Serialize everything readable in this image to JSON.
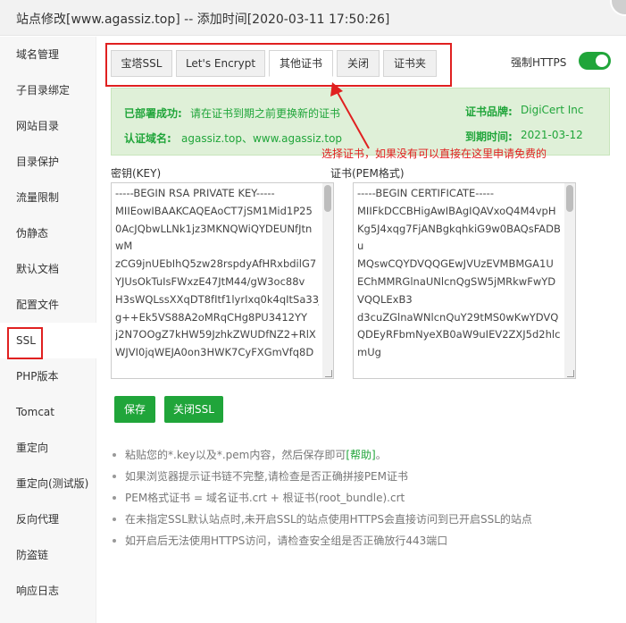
{
  "window": {
    "title": "站点修改[www.agassiz.top] -- 添加时间[2020-03-11 17:50:26]"
  },
  "sidebar": {
    "items": [
      {
        "label": "域名管理"
      },
      {
        "label": "子目录绑定"
      },
      {
        "label": "网站目录"
      },
      {
        "label": "目录保护"
      },
      {
        "label": "流量限制"
      },
      {
        "label": "伪静态"
      },
      {
        "label": "默认文档"
      },
      {
        "label": "配置文件"
      },
      {
        "label": "SSL"
      },
      {
        "label": "PHP版本"
      },
      {
        "label": "Tomcat"
      },
      {
        "label": "重定向"
      },
      {
        "label": "重定向(测试版)"
      },
      {
        "label": "反向代理"
      },
      {
        "label": "防盗链"
      },
      {
        "label": "响应日志"
      }
    ],
    "active": "SSL"
  },
  "tabs": [
    {
      "label": "宝塔SSL"
    },
    {
      "label": "Let's Encrypt"
    },
    {
      "label": "其他证书"
    },
    {
      "label": "关闭"
    },
    {
      "label": "证书夹"
    }
  ],
  "active_tab": "其他证书",
  "force_https": {
    "label": "强制HTTPS",
    "enabled": true
  },
  "status": {
    "deployed_label": "已部署成功:",
    "deployed_text": "请在证书到期之前更换新的证书",
    "domain_label": "认证域名:",
    "domain_value": "agassiz.top、www.agassiz.top",
    "brand_label": "证书品牌:",
    "brand_value": "DigiCert Inc",
    "expiry_label": "到期时间:",
    "expiry_value": "2021-03-12"
  },
  "annotation": {
    "text": "选择证书，如果没有可以直接在这里申请免费的"
  },
  "key_field": {
    "label": "密钥(KEY)",
    "value": "-----BEGIN RSA PRIVATE KEY-----\nMIIEowIBAAKCAQEAoCT7jSM1Mid1P25\n0AcJQbwLLNk1jz3MKNQWiQYDEUNfJtn\nwM\nzCG9jnUEbIhQ5zw28rspdyAfHRxbdilG7\nYJUsOkTuIsFWxzE47JtM44/gW3oc88v\nH3sWQLssXXqDT8fItf1lyrIxq0k4qItSa33J\ng++Ek5VS88A2oMRqCHg8PU3412YY\nj2N7OOgZ7kHW59JzhkZWUDfNZ2+RlX\nWJVI0jqWEJA0on3HWK7CyFXGmVfq8D"
  },
  "cert_field": {
    "label": "证书(PEM格式)",
    "value": "-----BEGIN CERTIFICATE-----\nMIIFkDCCBHigAwIBAgIQAVxoQ4M4vpH\nKg5J4xqg7FjANBgkqhkiG9w0BAQsFADB\nu\nMQswCQYDVQQGEwJVUzEVMBMGA1U\nEChMMRGlnaUNlcnQgSW5jMRkwFwYD\nVQQLExB3\nd3cuZGlnaWNlcnQuY29tMS0wKwYDVQ\nQDEyRFbmNyeXB0aW9uIEV2ZXJ5d2hlc\nmUg"
  },
  "buttons": {
    "save": "保存",
    "close_ssl": "关闭SSL"
  },
  "tips": [
    {
      "text": "粘贴您的*.key以及*.pem内容，然后保存即可",
      "link": "[帮助]",
      "suffix": "。"
    },
    {
      "text": "如果浏览器提示证书链不完整,请检查是否正确拼接PEM证书"
    },
    {
      "text": "PEM格式证书 = 域名证书.crt + 根证书(root_bundle).crt"
    },
    {
      "text": "在未指定SSL默认站点时,未开启SSL的站点使用HTTPS会直接访问到已开启SSL的站点"
    },
    {
      "text": "如开启后无法使用HTTPS访问，请检查安全组是否正确放行443端口"
    }
  ],
  "colors": {
    "accent": "#20a53a",
    "annotation_red": "#e02020",
    "status_bg": "#dff0d8"
  }
}
